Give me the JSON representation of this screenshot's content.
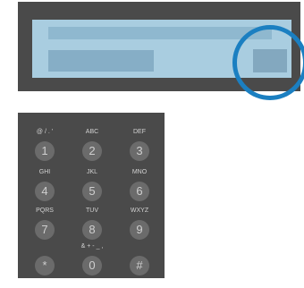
{
  "keypad": {
    "rows": [
      [
        {
          "digit": "1",
          "letters": "@ / . '"
        },
        {
          "digit": "2",
          "letters": "ABC"
        },
        {
          "digit": "3",
          "letters": "DEF"
        }
      ],
      [
        {
          "digit": "4",
          "letters": "GHI"
        },
        {
          "digit": "5",
          "letters": "JKL"
        },
        {
          "digit": "6",
          "letters": "MNO"
        }
      ],
      [
        {
          "digit": "7",
          "letters": "PQRS"
        },
        {
          "digit": "8",
          "letters": "TUV"
        },
        {
          "digit": "9",
          "letters": "WXYZ"
        }
      ],
      [
        {
          "digit": "*",
          "letters": ""
        },
        {
          "digit": "0",
          "letters": "& + - _ ,"
        },
        {
          "digit": "#",
          "letters": ""
        }
      ]
    ]
  },
  "colors": {
    "panel": "#4a4a4a",
    "screen": "#a9cde0",
    "highlight": "#1b7fc1"
  },
  "icons": {
    "star_key": "asterisk-icon",
    "hash_key": "hash-icon"
  }
}
